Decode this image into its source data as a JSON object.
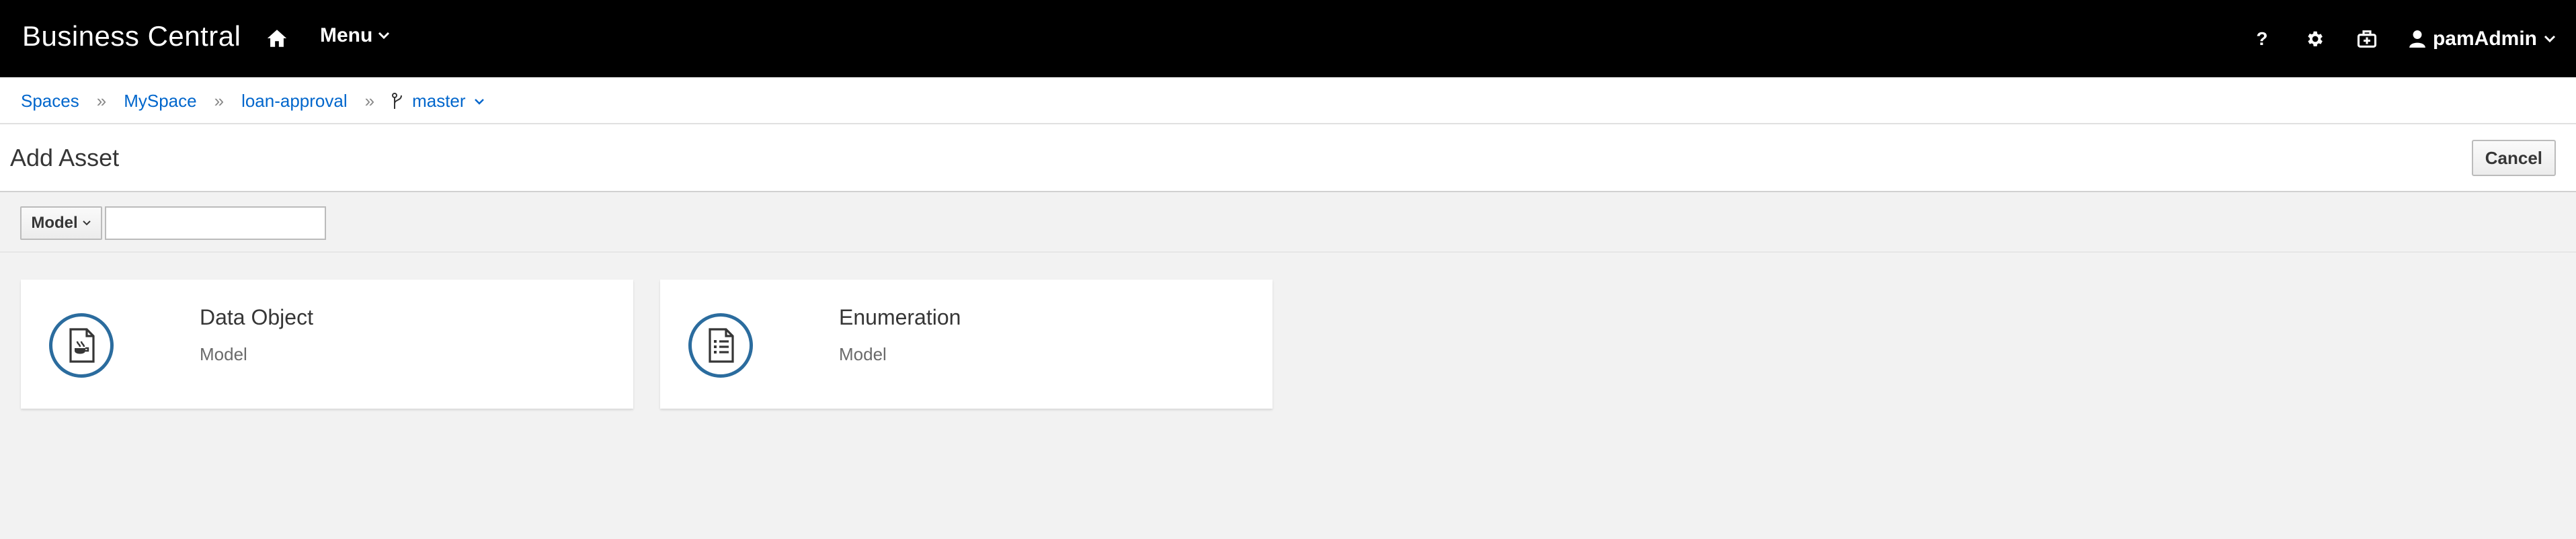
{
  "app": {
    "brand": "Business Central",
    "menu_label": "Menu"
  },
  "navbar": {
    "help_label": "?",
    "user_name": "pamAdmin"
  },
  "breadcrumb": {
    "items": [
      "Spaces",
      "MySpace",
      "loan-approval"
    ],
    "separator": "»",
    "branch": "master"
  },
  "page": {
    "title": "Add Asset",
    "cancel_label": "Cancel"
  },
  "filter": {
    "selected": "Model",
    "query": ""
  },
  "cards": [
    {
      "title": "Data Object",
      "category": "Model",
      "icon": "data-object-icon"
    },
    {
      "title": "Enumeration",
      "category": "Model",
      "icon": "enumeration-icon"
    }
  ],
  "colors": {
    "navbar": "#000000",
    "link": "#0066cc",
    "icon_ring": "#2b6c9e",
    "background": "#f2f2f2"
  }
}
